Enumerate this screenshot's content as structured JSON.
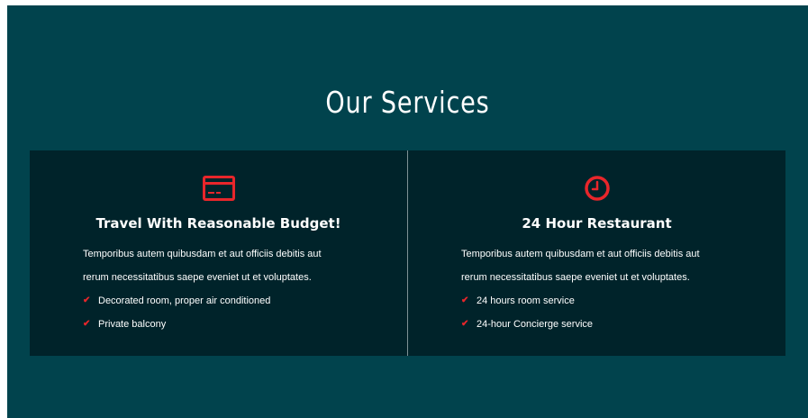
{
  "section": {
    "title": "Our Services",
    "accent_color": "#e8262b",
    "background_color": "#01434d",
    "card_background_color": "#00232a"
  },
  "services": [
    {
      "icon": "credit-card-icon",
      "title": "Travel With Reasonable Budget!",
      "text_line1": "Temporibus autem quibusdam et aut officiis debitis aut",
      "text_line2": "rerum necessitatibus saepe eveniet ut et voluptates.",
      "features": [
        "Decorated room, proper air conditioned",
        "Private balcony"
      ]
    },
    {
      "icon": "clock-icon",
      "title": "24 Hour Restaurant",
      "text_line1": "Temporibus autem quibusdam et aut officiis debitis aut",
      "text_line2": "rerum necessitatibus saepe eveniet ut et voluptates.",
      "features": [
        "24 hours room service",
        "24-hour Concierge service"
      ]
    }
  ],
  "check_glyph": "✔"
}
